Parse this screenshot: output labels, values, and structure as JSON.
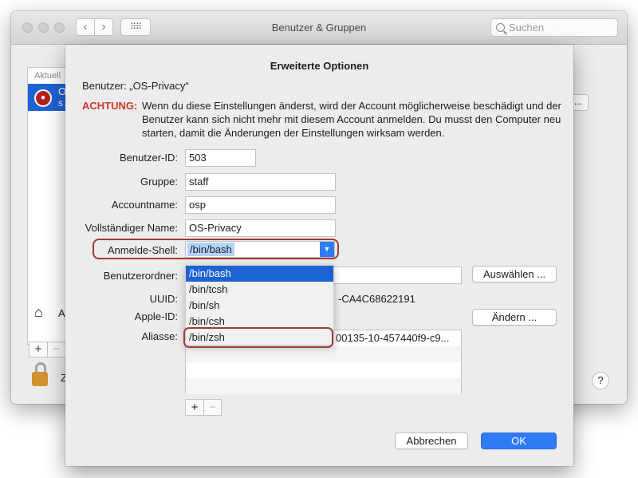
{
  "window": {
    "title": "Benutzer & Gruppen",
    "search_placeholder": "Suchen",
    "sidebar_header": "Aktuell",
    "selected_user_line1": "O",
    "selected_user_line2": "s",
    "home_label": "A",
    "lock_label": "Z",
    "help_label": "?",
    "options_button_label": "..."
  },
  "sheet": {
    "title": "Erweiterte Optionen",
    "user_line": "Benutzer:  „OS-Privacy“",
    "warning_label": "ACHTUNG:",
    "warning_text": "Wenn du diese Einstellungen änderst, wird der Account möglicherweise beschädigt und der Benutzer kann sich nicht mehr mit diesem Account anmelden. Du musst den Computer neu starten, damit die Änderungen der Einstellungen wirksam werden.",
    "fields": {
      "user_id_label": "Benutzer-ID:",
      "user_id_value": "503",
      "group_label": "Gruppe:",
      "group_value": "staff",
      "account_label": "Accountname:",
      "account_value": "osp",
      "fullname_label": "Vollständiger Name:",
      "fullname_value": "OS-Privacy",
      "shell_label": "Anmelde-Shell:",
      "shell_value": "/bin/bash",
      "home_label": "Benutzerordner:",
      "uuid_label": "UUID:",
      "uuid_value_visible": "-CA4C68622191",
      "appleid_label": "Apple-ID:",
      "aliases_label": "Aliasse:",
      "alias_value_visible": "00135-10-457440f9-c9..."
    },
    "shell_options": [
      "/bin/bash",
      "/bin/tcsh",
      "/bin/sh",
      "/bin/csh",
      "/bin/zsh"
    ],
    "buttons": {
      "choose": "Auswählen ...",
      "change": "Ändern ...",
      "cancel": "Abbrechen",
      "ok": "OK",
      "plus": "+",
      "minus": "−"
    }
  }
}
